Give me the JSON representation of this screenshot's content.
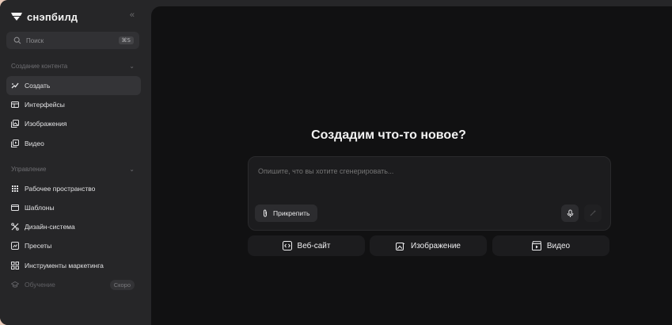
{
  "brand": {
    "name": "снэпбилд"
  },
  "search": {
    "placeholder": "Поиск",
    "shortcut": "⌘S"
  },
  "sections": [
    {
      "title": "Создание контента"
    },
    {
      "title": "Управление"
    }
  ],
  "nav_content": [
    {
      "label": "Создать",
      "icon": "sparkle-pen-icon",
      "active": true
    },
    {
      "label": "Интерфейсы",
      "icon": "window-icon"
    },
    {
      "label": "Изображения",
      "icon": "images-icon"
    },
    {
      "label": "Видео",
      "icon": "video-icon"
    }
  ],
  "nav_manage": [
    {
      "label": "Рабочее пространство",
      "icon": "grid-dots-icon"
    },
    {
      "label": "Шаблоны",
      "icon": "template-icon"
    },
    {
      "label": "Дизайн-система",
      "icon": "design-system-icon"
    },
    {
      "label": "Пресеты",
      "icon": "presets-icon"
    },
    {
      "label": "Инструменты маркетинга",
      "icon": "marketing-tools-icon"
    },
    {
      "label": "Обучение",
      "icon": "graduation-cap-icon",
      "badge": "Скоро",
      "disabled": true
    }
  ],
  "main": {
    "headline": "Создадим что-то новое?",
    "prompt_placeholder": "Опишите, что вы хотите сгенерировать...",
    "attach_label": "Прикрепить",
    "modes": [
      {
        "label": "Веб-сайт",
        "icon": "code-window-icon"
      },
      {
        "label": "Изображение",
        "icon": "image-edit-icon"
      },
      {
        "label": "Видео",
        "icon": "clapperboard-icon"
      }
    ]
  },
  "colors": {
    "sidebar_bg": "#262628",
    "main_bg": "#111112",
    "active_item_bg": "#343437",
    "text": "#e6e6e6",
    "muted": "#6e6e72"
  }
}
